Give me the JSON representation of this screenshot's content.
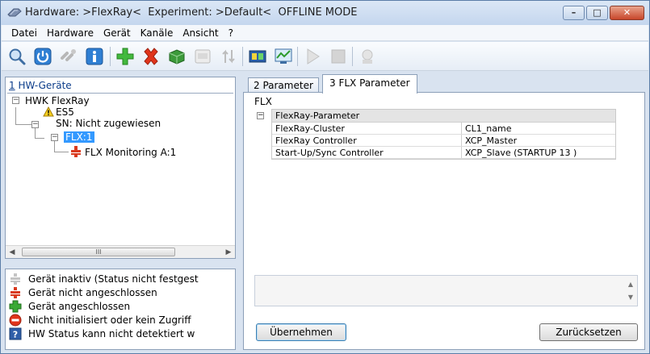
{
  "window": {
    "title": "Hardware: >FlexRay<  Experiment: >Default<  OFFLINE MODE",
    "buttons": {
      "minimize": "–",
      "maximize": "□",
      "close": "✕"
    }
  },
  "menu": [
    "Datei",
    "Hardware",
    "Gerät",
    "Kanäle",
    "Ansicht",
    "?"
  ],
  "toolbar": {
    "icons": [
      "search-icon",
      "power-icon",
      "disconnect-icon",
      "info-icon",
      "add-icon",
      "delete-icon",
      "module-icon",
      "io-card-icon",
      "transfer-icon",
      "hardware-config-icon",
      "monitor-icon",
      "play-icon",
      "stop-icon",
      "tools-icon"
    ]
  },
  "left_panel": {
    "title_num": "1",
    "title_text": " HW-Geräte",
    "tree": {
      "root": "HWK FlexRay",
      "es5": "ES5",
      "sn": "SN: Nicht zugewiesen",
      "flx": "FLX:1",
      "monitoring": "FLX Monitoring A:1"
    },
    "scroll_thumb": "III"
  },
  "legend": [
    {
      "icon": "inactive-icon",
      "text": "Gerät inaktiv (Status nicht festgest"
    },
    {
      "icon": "not-connected-icon",
      "text": "Gerät nicht angeschlossen"
    },
    {
      "icon": "connected-icon",
      "text": "Gerät angeschlossen"
    },
    {
      "icon": "no-access-icon",
      "text": "Nicht initialisiert oder kein Zugriff"
    },
    {
      "icon": "unknown-status-icon",
      "text": "HW Status kann nicht detektiert w"
    }
  ],
  "tabs": [
    {
      "label": "2 Parameter",
      "active": false
    },
    {
      "label": "3 FLX  Parameter",
      "active": true
    }
  ],
  "params": {
    "section": "FLX",
    "group": "FlexRay-Parameter",
    "rows": [
      {
        "key": "FlexRay-Cluster",
        "value": "CL1_name"
      },
      {
        "key": "FlexRay Controller",
        "value": "XCP_Master"
      },
      {
        "key": "Start-Up/Sync Controller",
        "value": "XCP_Slave (STARTUP 13 )"
      }
    ]
  },
  "buttons": {
    "apply": "Übernehmen",
    "reset": "Zurücksetzen"
  },
  "colors": {
    "selection": "#3399ff",
    "frame": "#d9e3f0",
    "red": "#d93a1f",
    "green": "#3aa935"
  }
}
